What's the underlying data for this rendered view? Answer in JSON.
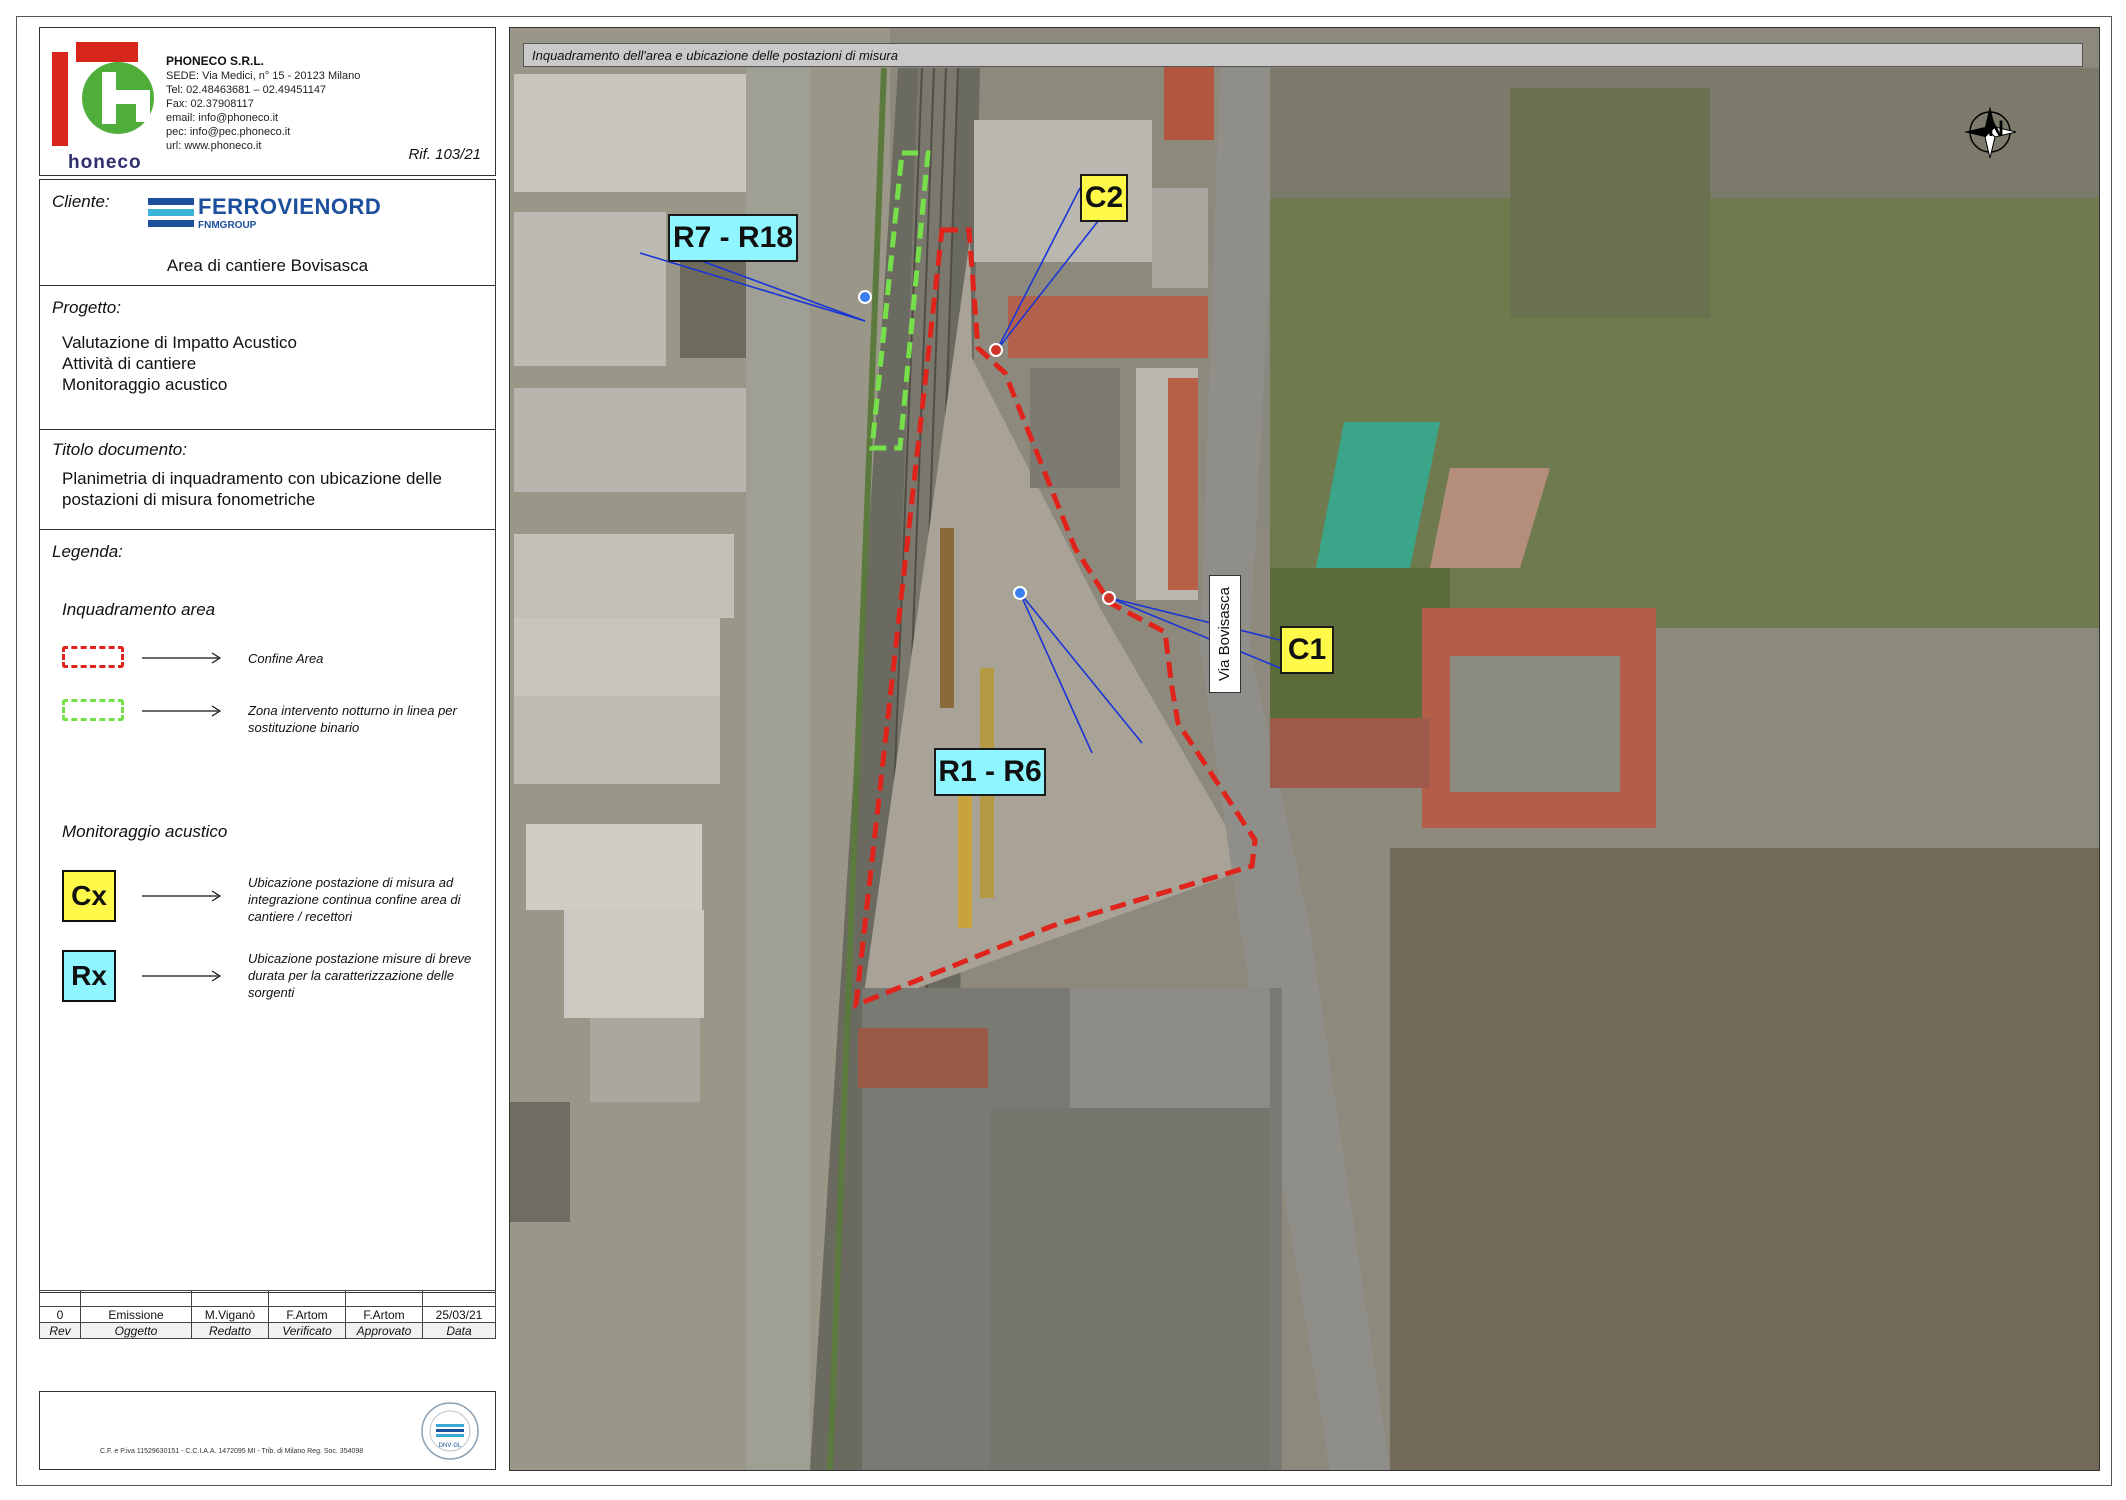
{
  "company": {
    "name": "PHONECO S.R.L.",
    "lines": [
      "SEDE: Via Medici, n° 15 - 20123 Milano",
      "Tel: 02.48463681 – 02.49451147",
      "Fax: 02.37908117",
      "email: info@phoneco.it",
      "pec: info@pec.phoneco.it",
      "url: www.phoneco.it"
    ],
    "logo_text": "honeco",
    "ref": "Rif. 103/21"
  },
  "client": {
    "label": "Cliente:",
    "logo_name": "FERROVIENORD",
    "logo_group": "FNMGROUP",
    "site": "Area di cantiere Bovisasca"
  },
  "project": {
    "label": "Progetto:",
    "lines": [
      "Valutazione di Impatto Acustico",
      "Attività di cantiere",
      "Monitoraggio acustico"
    ]
  },
  "document_title": {
    "label": "Titolo documento:",
    "lines": [
      "Planimetria di inquadramento con ubicazione delle",
      "postazioni di misura fonometriche"
    ]
  },
  "legend": {
    "label": "Legenda:",
    "area_heading": "Inquadramento area",
    "items_area": [
      {
        "symbol": "red-dashed",
        "desc": "Confine Area"
      },
      {
        "symbol": "green-dashed",
        "desc": "Zona intervento notturno in linea per sostituzione binario"
      }
    ],
    "monitoring_heading": "Monitoraggio acustico",
    "items_monitoring": [
      {
        "symbol": "Cx",
        "desc": "Ubicazione postazione di misura ad integrazione continua confine area di cantiere / recettori"
      },
      {
        "symbol": "Rx",
        "desc": "Ubicazione postazione misure di breve durata per la caratterizzazione delle sorgenti"
      }
    ]
  },
  "revision": {
    "row": [
      "0",
      "Emissione",
      "M.Viganò",
      "F.Artom",
      "F.Artom",
      "25/03/21"
    ],
    "headers": [
      "Rev",
      "Oggetto",
      "Redatto",
      "Verificato",
      "Approvato",
      "Data"
    ]
  },
  "footer": {
    "legal": "C.F. e P.iva 11529630151 - C.C.I.A.A. 1472095 MI - Trib. di Milano Reg. Soc. 354098",
    "cert": "DNV·GL"
  },
  "map": {
    "title": "Inquadramento dell'area e ubicazione delle postazioni di misura",
    "street": "Via Bovisasca",
    "north": "N",
    "labels": {
      "r7_r18": "R7 - R18",
      "c2": "C2",
      "c1": "C1",
      "r1_r6": "R1 - R6"
    },
    "colors": {
      "site_boundary": "#e0241b",
      "night_work_zone": "#76e04a",
      "r_label": "#8ff5ff",
      "c_label": "#fff94a",
      "leader_line": "#1a35d6"
    }
  }
}
